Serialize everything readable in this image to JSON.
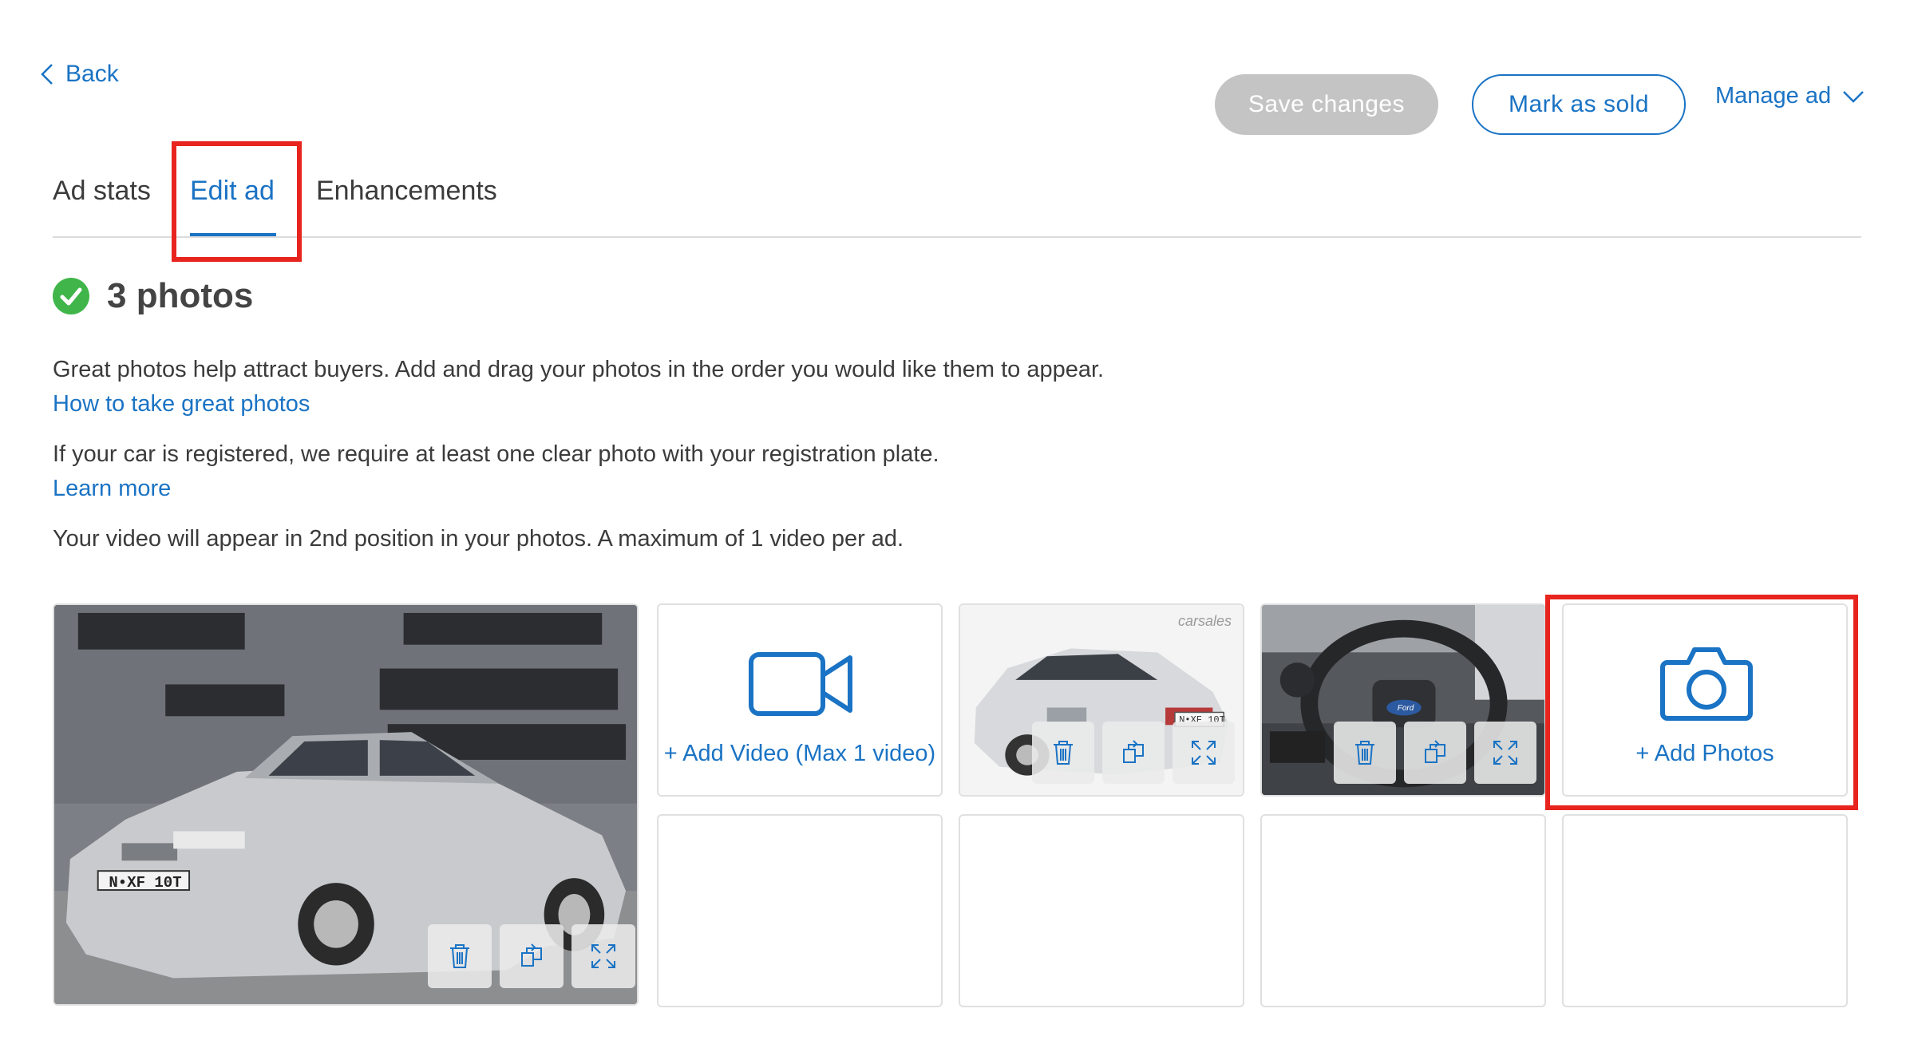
{
  "header": {
    "back_label": "Back",
    "save_label": "Save changes",
    "mark_sold_label": "Mark as sold",
    "manage_label": "Manage ad"
  },
  "tabs": [
    {
      "label": "Ad stats",
      "active": false
    },
    {
      "label": "Edit ad",
      "active": true
    },
    {
      "label": "Enhancements",
      "active": false
    }
  ],
  "photos": {
    "heading": "3 photos",
    "desc1": "Great photos help attract buyers. Add and drag your photos in the order you would like them to appear.",
    "link1": "How to take great photos",
    "desc2": "If your car is registered, we require at least one clear photo with your registration plate.",
    "link2": "Learn more",
    "desc3": "Your video will appear in 2nd position in your photos. A maximum of 1 video per ad.",
    "add_video_label": "+ Add Video (Max 1 video)",
    "add_photos_label": "+ Add Photos",
    "plate_main": "N•XF 10T",
    "plate_rear": "N•XF 10T",
    "watermark": "carsales",
    "steering_badge": "Ford"
  },
  "colors": {
    "accent": "#1a73c4",
    "success": "#3fb54a",
    "highlight": "#e8241f",
    "disabled": "#c4c4c4"
  },
  "icons": [
    "chevron-left-icon",
    "chevron-down-icon",
    "check-circle-icon",
    "video-camera-icon",
    "camera-icon",
    "trash-icon",
    "rotate-icon",
    "expand-icon"
  ]
}
